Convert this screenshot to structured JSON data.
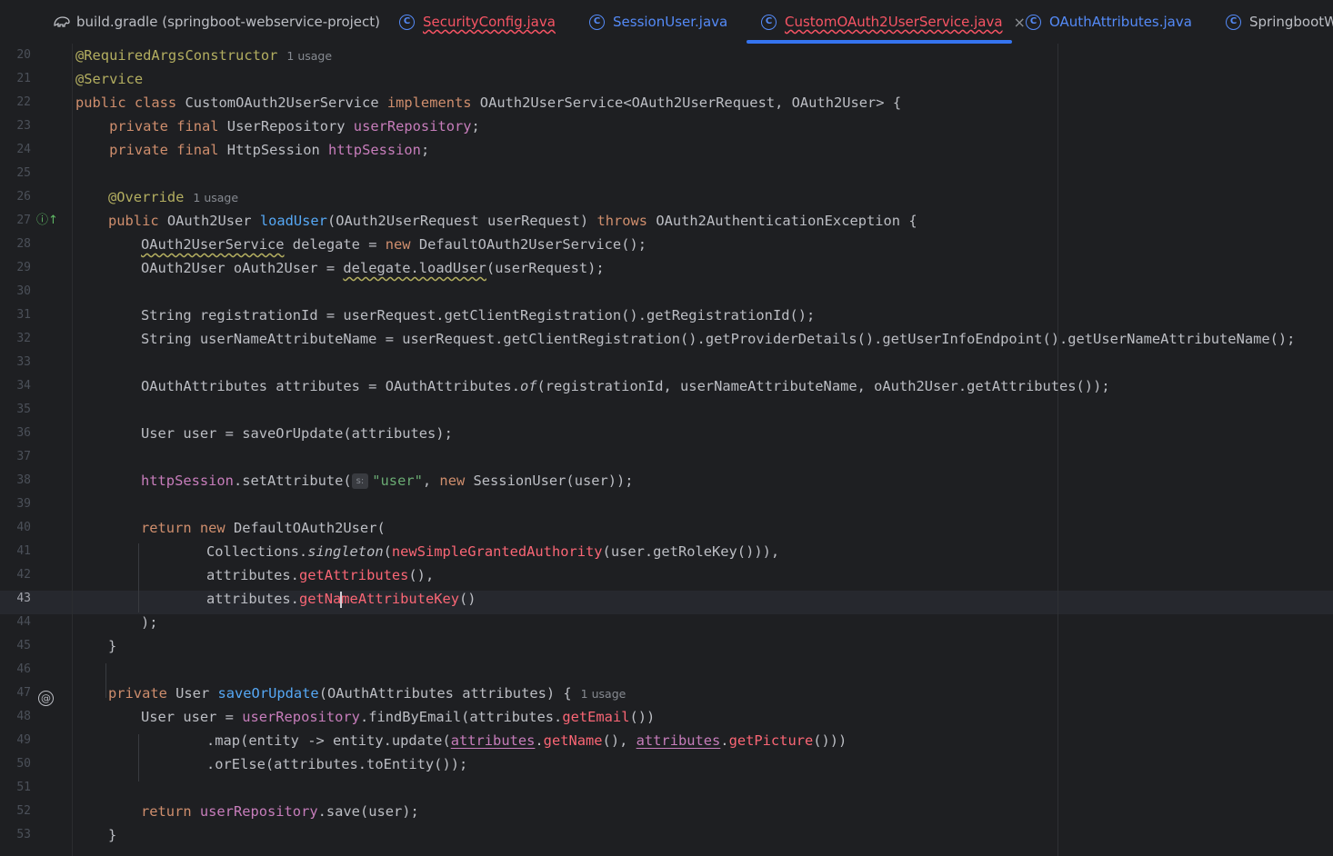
{
  "tabs": [
    {
      "label": "build.gradle (springboot-webservice-project)",
      "icon": "gradle-icon"
    },
    {
      "label": "SecurityConfig.java",
      "icon": "C",
      "state": "error"
    },
    {
      "label": "SessionUser.java",
      "icon": "C",
      "state": "modified"
    },
    {
      "label": "CustomOAuth2UserService.java",
      "icon": "C",
      "state": "error",
      "active": true,
      "close": "×"
    },
    {
      "label": "OAuthAttributes.java",
      "icon": "C",
      "state": "modified"
    },
    {
      "label": "SpringbootWe",
      "icon": "C"
    }
  ],
  "editor": {
    "current_line": 43,
    "usage_hint": "1 usage",
    "param_hint": "s:",
    "line_numbers": [
      "20",
      "21",
      "22",
      "23",
      "24",
      "25",
      "26",
      "27",
      "28",
      "29",
      "30",
      "31",
      "32",
      "33",
      "34",
      "35",
      "36",
      "37",
      "38",
      "39",
      "40",
      "41",
      "42",
      "43",
      "44",
      "45",
      "46",
      "47",
      "48",
      "49",
      "50",
      "51",
      "52",
      "53"
    ],
    "code": {
      "l20_anno": "@RequiredArgsConstructor",
      "l21_anno": "@Service",
      "l22_kw": "public class ",
      "l22_name": "CustomOAuth2UserService ",
      "l22_impl": "implements ",
      "l22_rest": "OAuth2UserService<OAuth2UserRequest, OAuth2User> {",
      "l23_kw": "    private final ",
      "l23_type": "UserRepository ",
      "l23_field": "userRepository",
      "l23_end": ";",
      "l24_kw": "    private final ",
      "l24_type": "HttpSession ",
      "l24_field": "httpSession",
      "l24_end": ";",
      "l26_anno": "@Override",
      "l27_kw": "public ",
      "l27_type": "OAuth2User ",
      "l27_method": "loadUser",
      "l27_params": "(OAuth2UserRequest userRequest) ",
      "l27_throws": "throws ",
      "l27_rest": "OAuth2AuthenticationException {",
      "l28_type": "OAuth2UserService",
      "l28_mid": " delegate = ",
      "l28_new": "new ",
      "l28_rest": "DefaultOAuth2UserService();",
      "l29_a": "OAuth2User oAuth2User = ",
      "l29_call": "delegate.loadUser",
      "l29_rest": "(userRequest);",
      "l31": "String registrationId = userRequest.getClientRegistration().getRegistrationId();",
      "l32": "String userNameAttributeName = userRequest.getClientRegistration().getProviderDetails().getUserInfoEndpoint().getUserNameAttributeName();",
      "l34_a": "OAuthAttributes attributes = OAuthAttributes.",
      "l34_of": "of",
      "l34_rest": "(registrationId, userNameAttributeName, oAuth2User.getAttributes());",
      "l36": "User user = saveOrUpdate(attributes);",
      "l38_field": "httpSession",
      "l38_a": ".setAttribute(",
      "l38_str": "\"user\"",
      "l38_b": ", ",
      "l38_new": "new ",
      "l38_rest": "SessionUser(user));",
      "l40_ret": "return new ",
      "l40_rest": "DefaultOAuth2User(",
      "l41_a": "Collections.",
      "l41_single": "singleton",
      "l41_b": "(",
      "l41_err": "newSimpleGrantedAuthority",
      "l41_rest": "(user.getRoleKey())),",
      "l42_a": "attributes.",
      "l42_err": "getAttributes",
      "l42_rest": "(),",
      "l43_a": "attributes.",
      "l43_err1": "getNa",
      "l43_err2": "meAttributeKey",
      "l43_rest": "()",
      "l44": ");",
      "l45": "}",
      "l47_kw": "private ",
      "l47_type": "User ",
      "l47_method": "saveOrUpdate",
      "l47_rest": "(OAuthAttributes attributes) {",
      "l48_a": "User user = ",
      "l48_field": "userRepository",
      "l48_b": ".findByEmail(attributes.",
      "l48_err": "getEmail",
      "l48_rest": "())",
      "l49_a": ".map(entity -> entity.update(",
      "l49_attr1": "attributes",
      "l49_dot1": ".",
      "l49_err1": "getName",
      "l49_b": "(), ",
      "l49_attr2": "attributes",
      "l49_dot2": ".",
      "l49_err2": "getPicture",
      "l49_rest": "()))",
      "l50": ".orElse(attributes.toEntity());",
      "l52_ret": "return ",
      "l52_field": "userRepository",
      "l52_rest": ".save(user);",
      "l53": "}"
    }
  }
}
